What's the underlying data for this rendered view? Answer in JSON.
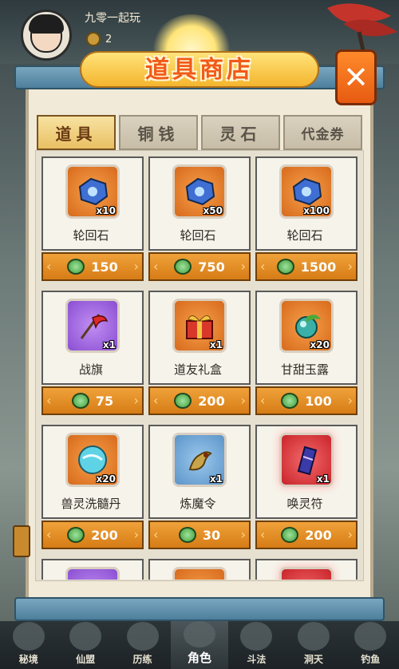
{
  "player": {
    "name": "九零一起玩",
    "coins": "2"
  },
  "shop": {
    "title": "道具商店",
    "close_label": "✕",
    "tabs": [
      {
        "label": "道具",
        "active": true
      },
      {
        "label": "铜钱",
        "active": false
      },
      {
        "label": "灵石",
        "active": false
      },
      {
        "label": "代金券",
        "active": false
      }
    ],
    "items": [
      {
        "name": "轮回石",
        "qty": "x10",
        "price": "150",
        "icon": "blue-stone-icon",
        "bg": "orange"
      },
      {
        "name": "轮回石",
        "qty": "x50",
        "price": "750",
        "icon": "blue-stone-icon",
        "bg": "orange"
      },
      {
        "name": "轮回石",
        "qty": "x100",
        "price": "1500",
        "icon": "blue-stone-icon",
        "bg": "orange"
      },
      {
        "name": "战旗",
        "qty": "x1",
        "price": "75",
        "icon": "war-flag-icon",
        "bg": "purple"
      },
      {
        "name": "道友礼盒",
        "qty": "x1",
        "price": "200",
        "icon": "gift-box-icon",
        "bg": "orange"
      },
      {
        "name": "甘甜玉露",
        "qty": "x20",
        "price": "100",
        "icon": "jade-dew-icon",
        "bg": "orange"
      },
      {
        "name": "兽灵洗髓丹",
        "qty": "x20",
        "price": "200",
        "icon": "spirit-pill-icon",
        "bg": "orange"
      },
      {
        "name": "炼魔令",
        "qty": "x1",
        "price": "30",
        "icon": "demon-token-icon",
        "bg": "blue"
      },
      {
        "name": "唤灵符",
        "qty": "x1",
        "price": "200",
        "icon": "summon-talisman-icon",
        "bg": "red"
      }
    ]
  },
  "nav": [
    {
      "label": "秘境",
      "active": false
    },
    {
      "label": "仙盟",
      "active": false
    },
    {
      "label": "历练",
      "active": false
    },
    {
      "label": "角色",
      "active": true
    },
    {
      "label": "斗法",
      "active": false
    },
    {
      "label": "洞天",
      "active": false
    },
    {
      "label": "钓鱼",
      "active": false
    }
  ],
  "colors": {
    "accent_orange": "#e75b12",
    "title_text": "#f25a18",
    "price_bar": "#d67c16",
    "scroll_rod": "#4d7f9c"
  }
}
